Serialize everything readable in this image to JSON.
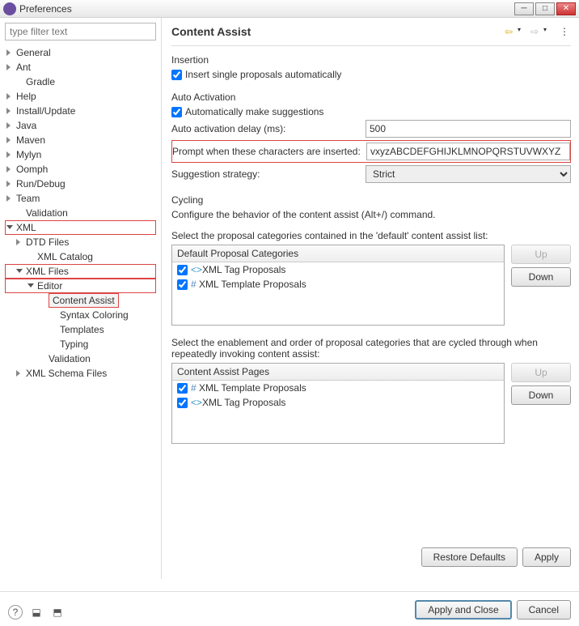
{
  "window": {
    "title": "Preferences"
  },
  "filter": {
    "placeholder": "type filter text"
  },
  "tree": [
    {
      "label": "General",
      "tw": "c",
      "cls": ""
    },
    {
      "label": "Ant",
      "tw": "c",
      "cls": ""
    },
    {
      "label": "Gradle",
      "tw": "",
      "cls": "in1"
    },
    {
      "label": "Help",
      "tw": "c",
      "cls": ""
    },
    {
      "label": "Install/Update",
      "tw": "c",
      "cls": ""
    },
    {
      "label": "Java",
      "tw": "c",
      "cls": ""
    },
    {
      "label": "Maven",
      "tw": "c",
      "cls": ""
    },
    {
      "label": "Mylyn",
      "tw": "c",
      "cls": ""
    },
    {
      "label": "Oomph",
      "tw": "c",
      "cls": ""
    },
    {
      "label": "Run/Debug",
      "tw": "c",
      "cls": ""
    },
    {
      "label": "Team",
      "tw": "c",
      "cls": ""
    },
    {
      "label": "Validation",
      "tw": "",
      "cls": "in1"
    },
    {
      "label": "XML",
      "tw": "e",
      "cls": "",
      "red": true
    },
    {
      "label": "DTD Files",
      "tw": "c",
      "cls": "in1"
    },
    {
      "label": "XML Catalog",
      "tw": "",
      "cls": "in2"
    },
    {
      "label": "XML Files",
      "tw": "e",
      "cls": "in1",
      "red": true
    },
    {
      "label": "Editor",
      "tw": "e",
      "cls": "in2",
      "red": true
    },
    {
      "label": "Content Assist",
      "tw": "",
      "cls": "in3",
      "red": true,
      "boxed": true
    },
    {
      "label": "Syntax Coloring",
      "tw": "",
      "cls": "in4"
    },
    {
      "label": "Templates",
      "tw": "",
      "cls": "in4"
    },
    {
      "label": "Typing",
      "tw": "",
      "cls": "in4"
    },
    {
      "label": "Validation",
      "tw": "",
      "cls": "in3"
    },
    {
      "label": "XML Schema Files",
      "tw": "c",
      "cls": "in1"
    }
  ],
  "page": {
    "title": "Content Assist",
    "insertion_hdr": "Insertion",
    "cb_insert": "Insert single proposals automatically",
    "auto_hdr": "Auto Activation",
    "cb_autosuggest": "Automatically make suggestions",
    "delay_label": "Auto activation delay (ms):",
    "delay_value": "500",
    "prompt_label": "Prompt when these characters are inserted:",
    "prompt_value": "vxyzABCDEFGHIJKLMNOPQRSTUVWXYZ",
    "strategy_label": "Suggestion strategy:",
    "strategy_value": "Strict",
    "cycling_hdr": "Cycling",
    "cycling_desc": "Configure the behavior of the content assist (Alt+/) command.",
    "default_desc": "Select the proposal categories contained in the 'default' content assist list:",
    "default_th": "Default Proposal Categories",
    "tag_proposals": "XML Tag Proposals",
    "tpl_proposals": "XML Template Proposals",
    "pages_desc": "Select the enablement and order of proposal categories that are cycled through when repeatedly invoking content assist:",
    "pages_th": "Content Assist Pages",
    "btn_up": "Up",
    "btn_down": "Down",
    "restore": "Restore Defaults",
    "apply": "Apply",
    "apply_close": "Apply and Close",
    "cancel": "Cancel"
  }
}
